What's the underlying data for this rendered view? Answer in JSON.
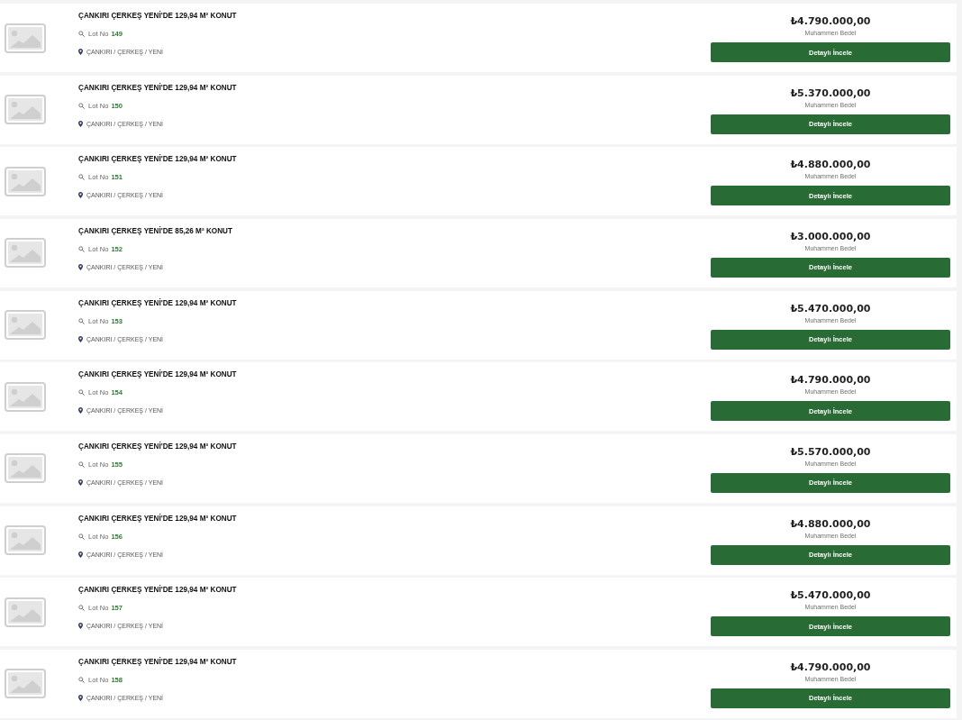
{
  "listings": [
    {
      "title": "ÇANKIRI ÇERKEŞ YENİ'DE 129,94 M² KONUT",
      "lot_label": "Lot No",
      "lot_number": "149",
      "location": "ÇANKIRI / ÇERKEŞ / YENİ",
      "price": "₺4.790.000,00",
      "price_label": "Muhammen Bedel",
      "button": "Detaylı İncele"
    },
    {
      "title": "ÇANKIRI ÇERKEŞ YENİ'DE 129,94 M² KONUT",
      "lot_label": "Lot No",
      "lot_number": "150",
      "location": "ÇANKIRI / ÇERKEŞ / YENİ",
      "price": "₺5.370.000,00",
      "price_label": "Muhammen Bedel",
      "button": "Detaylı İncele"
    },
    {
      "title": "ÇANKIRI ÇERKEŞ YENİ'DE 129,94 M² KONUT",
      "lot_label": "Lot No",
      "lot_number": "151",
      "location": "ÇANKIRI / ÇERKEŞ / YENİ",
      "price": "₺4.880.000,00",
      "price_label": "Muhammen Bedel",
      "button": "Detaylı İncele"
    },
    {
      "title": "ÇANKIRI ÇERKEŞ YENİ'DE 85,26 M² KONUT",
      "lot_label": "Lot No",
      "lot_number": "152",
      "location": "ÇANKIRI / ÇERKEŞ / YENİ",
      "price": "₺3.000.000,00",
      "price_label": "Muhammen Bedel",
      "button": "Detaylı İncele"
    },
    {
      "title": "ÇANKIRI ÇERKEŞ YENİ'DE 129,94 M² KONUT",
      "lot_label": "Lot No",
      "lot_number": "153",
      "location": "ÇANKIRI / ÇERKEŞ / YENİ",
      "price": "₺5.470.000,00",
      "price_label": "Muhammen Bedel",
      "button": "Detaylı İncele"
    },
    {
      "title": "ÇANKIRI ÇERKEŞ YENİ'DE 129,94 M² KONUT",
      "lot_label": "Lot No",
      "lot_number": "154",
      "location": "ÇANKIRI / ÇERKEŞ / YENİ",
      "price": "₺4.790.000,00",
      "price_label": "Muhammen Bedel",
      "button": "Detaylı İncele"
    },
    {
      "title": "ÇANKIRI ÇERKEŞ YENİ'DE 129,94 M² KONUT",
      "lot_label": "Lot No",
      "lot_number": "155",
      "location": "ÇANKIRI / ÇERKEŞ / YENİ",
      "price": "₺5.570.000,00",
      "price_label": "Muhammen Bedel",
      "button": "Detaylı İncele"
    },
    {
      "title": "ÇANKIRI ÇERKEŞ YENİ'DE 129,94 M² KONUT",
      "lot_label": "Lot No",
      "lot_number": "156",
      "location": "ÇANKIRI / ÇERKEŞ / YENİ",
      "price": "₺4.880.000,00",
      "price_label": "Muhammen Bedel",
      "button": "Detaylı İncele"
    },
    {
      "title": "ÇANKIRI ÇERKEŞ YENİ'DE 129,94 M² KONUT",
      "lot_label": "Lot No",
      "lot_number": "157",
      "location": "ÇANKIRI / ÇERKEŞ / YENİ",
      "price": "₺5.470.000,00",
      "price_label": "Muhammen Bedel",
      "button": "Detaylı İncele"
    },
    {
      "title": "ÇANKIRI ÇERKEŞ YENİ'DE 129,94 M² KONUT",
      "lot_label": "Lot No",
      "lot_number": "158",
      "location": "ÇANKIRI / ÇERKEŞ / YENİ",
      "price": "₺4.790.000,00",
      "price_label": "Muhammen Bedel",
      "button": "Detaylı İncele"
    }
  ]
}
